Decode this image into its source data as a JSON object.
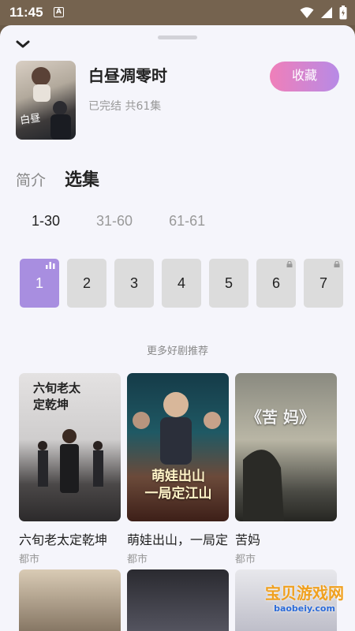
{
  "status": {
    "time": "11:45",
    "a_badge": "A"
  },
  "show": {
    "title": "白昼凋零时",
    "subtitle": "已完结 共61集",
    "favorite_label": "收藏"
  },
  "tabs": [
    {
      "label": "简介",
      "active": false
    },
    {
      "label": "选集",
      "active": true
    }
  ],
  "ranges": [
    {
      "label": "1-30",
      "active": true
    },
    {
      "label": "31-60",
      "active": false
    },
    {
      "label": "61-61",
      "active": false
    }
  ],
  "episodes": [
    {
      "label": "1",
      "active": true,
      "locked": false
    },
    {
      "label": "2",
      "active": false,
      "locked": false
    },
    {
      "label": "3",
      "active": false,
      "locked": false
    },
    {
      "label": "4",
      "active": false,
      "locked": false
    },
    {
      "label": "5",
      "active": false,
      "locked": false
    },
    {
      "label": "6",
      "active": false,
      "locked": true
    },
    {
      "label": "7",
      "active": false,
      "locked": true
    }
  ],
  "recommend": {
    "title": "更多好剧推荐",
    "items": [
      {
        "name": "六旬老太定乾坤",
        "tag": "都市",
        "poster_text": "六旬老太定乾坤"
      },
      {
        "name": "萌娃出山，一局定江山",
        "tag": "都市",
        "poster_text": "萌娃出山 一局定江山"
      },
      {
        "name": "苦妈",
        "tag": "都市",
        "poster_text": "《苦 妈》"
      }
    ]
  },
  "watermark": {
    "main": "宝贝游戏网",
    "sub": "baobeiy.com"
  },
  "colors": {
    "accent": "#a88ee0",
    "fav_gradient_start": "#f07fb9",
    "fav_gradient_end": "#b78ae6"
  }
}
